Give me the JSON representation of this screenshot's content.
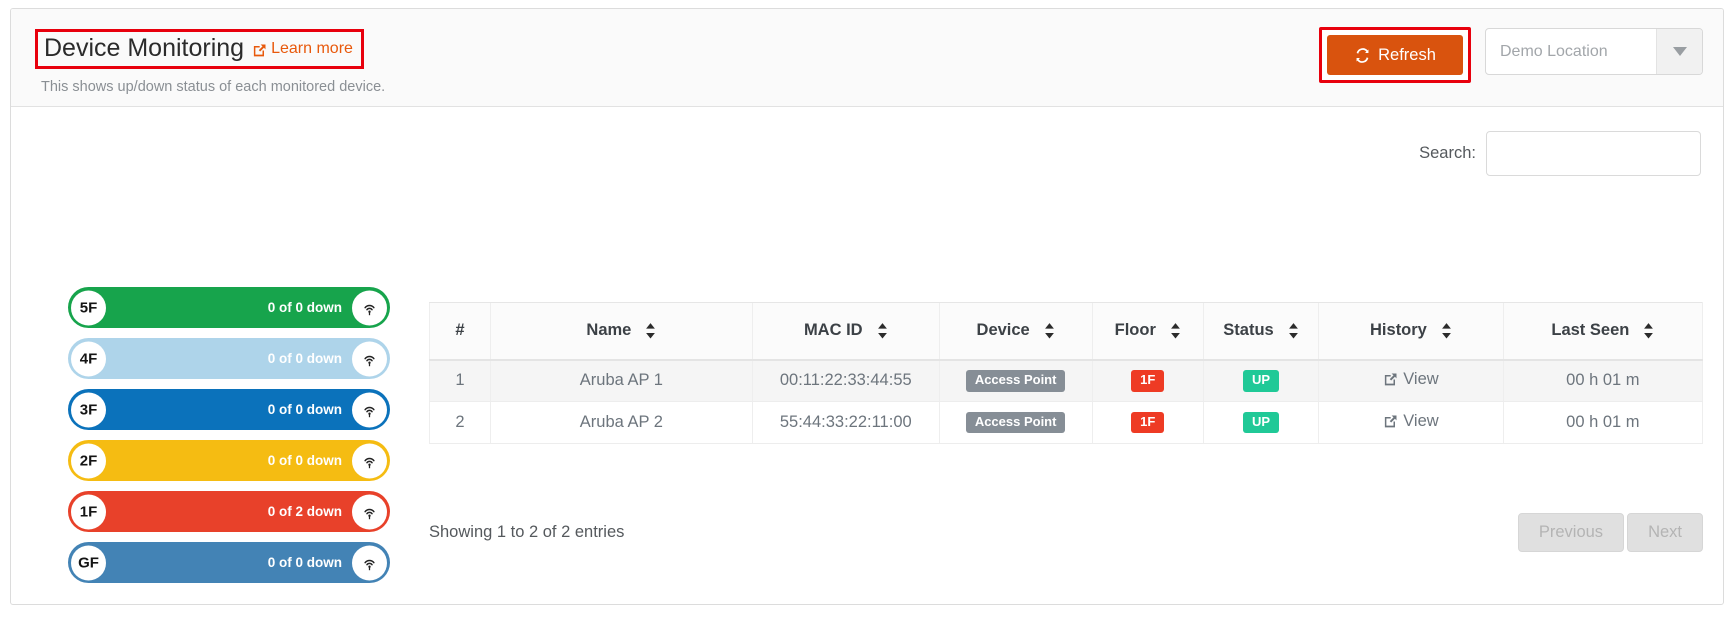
{
  "header": {
    "title": "Device Monitoring",
    "learn_more": "Learn more",
    "learn_more_icon": "external-link-icon",
    "subtitle": "This shows up/down status of each monitored device.",
    "refresh_label": "Refresh",
    "refresh_icon": "refresh-icon",
    "location_value": "Demo Location",
    "location_caret_icon": "chevron-down-icon",
    "accent_orange": "#d9530e",
    "highlight_red": "#e8000d",
    "link_orange": "#e8590c"
  },
  "search": {
    "label": "Search:",
    "value": "",
    "placeholder": ""
  },
  "floors": [
    {
      "name": "5F",
      "count": "0 of 0 down",
      "color": "#17a44c",
      "icon": "access-point-icon"
    },
    {
      "name": "4F",
      "count": "0 of 0 down",
      "color": "#aed4ea",
      "icon": "access-point-icon"
    },
    {
      "name": "3F",
      "count": "0 of 0 down",
      "color": "#0b72bb",
      "icon": "access-point-icon"
    },
    {
      "name": "2F",
      "count": "0 of 0 down",
      "color": "#f5bc12",
      "icon": "access-point-icon"
    },
    {
      "name": "1F",
      "count": "0 of 2 down",
      "color": "#e8412a",
      "icon": "access-point-icon"
    },
    {
      "name": "GF",
      "count": "0 of 0 down",
      "color": "#4383b5",
      "icon": "access-point-icon"
    }
  ],
  "table": {
    "columns": [
      {
        "label": "#",
        "sortable": false
      },
      {
        "label": "Name",
        "sortable": true
      },
      {
        "label": "MAC ID",
        "sortable": true
      },
      {
        "label": "Device",
        "sortable": true
      },
      {
        "label": "Floor",
        "sortable": true
      },
      {
        "label": "Status",
        "sortable": true
      },
      {
        "label": "History",
        "sortable": true
      },
      {
        "label": "Last Seen",
        "sortable": true
      }
    ],
    "rows": [
      {
        "index": "1",
        "name": "Aruba AP 1",
        "mac": "00:11:22:33:44:55",
        "device": "Access Point",
        "floor": "1F",
        "status": "UP",
        "history": "View",
        "last_seen": "00 h 01 m"
      },
      {
        "index": "2",
        "name": "Aruba AP 2",
        "mac": "55:44:33:22:11:00",
        "device": "Access Point",
        "floor": "1F",
        "status": "UP",
        "history": "View",
        "last_seen": "00 h 01 m"
      }
    ],
    "showing": "Showing 1 to 2 of 2 entries",
    "previous_label": "Previous",
    "next_label": "Next",
    "badge_colors": {
      "device": "#868e96",
      "floor": "#ee3b24",
      "status_up": "#20c997"
    }
  }
}
